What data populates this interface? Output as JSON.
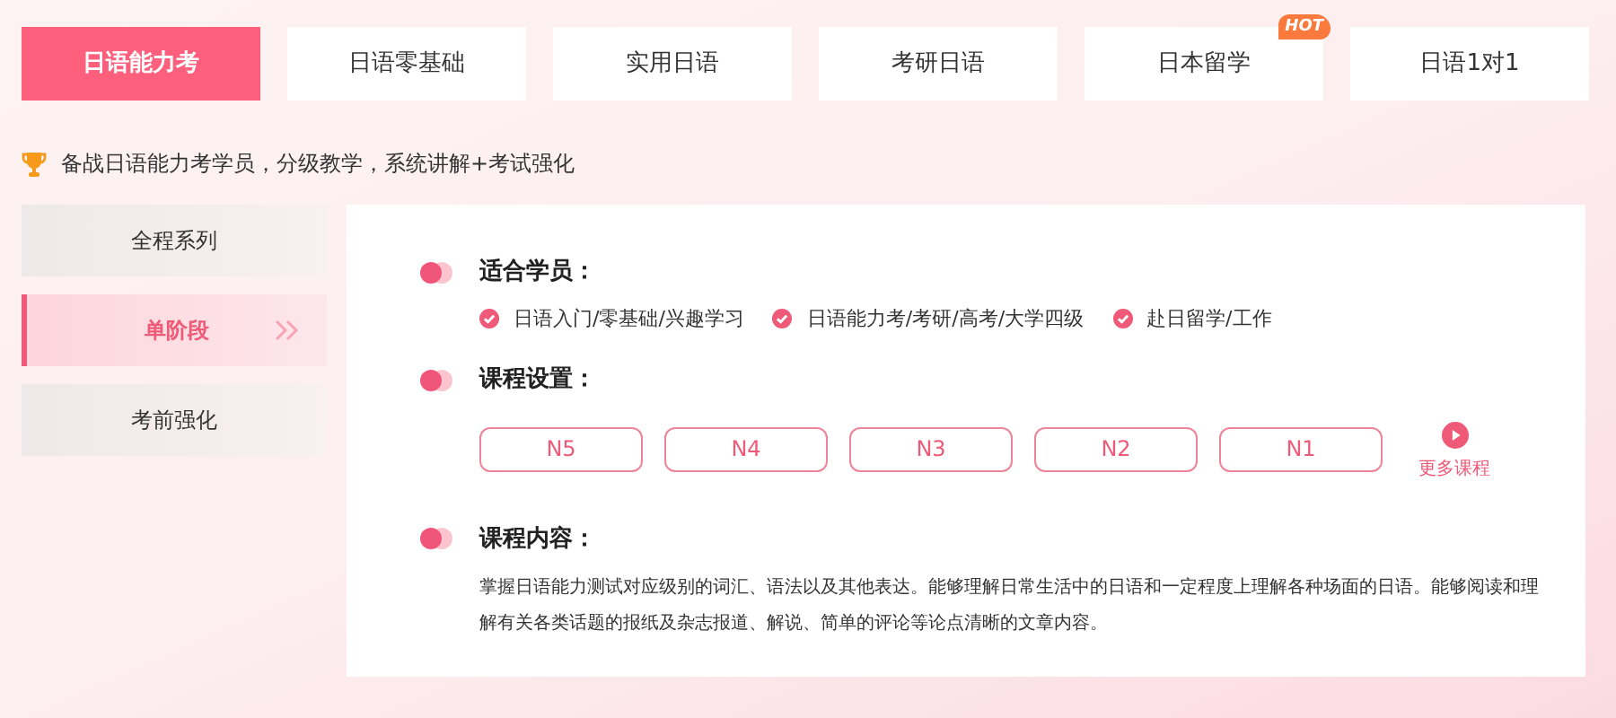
{
  "tabs": [
    {
      "label": "日语能力考",
      "selected": true
    },
    {
      "label": "日语零基础",
      "selected": false
    },
    {
      "label": "实用日语",
      "selected": false
    },
    {
      "label": "考研日语",
      "selected": false
    },
    {
      "label": "日本留学",
      "selected": false,
      "badge": "HOT"
    },
    {
      "label": "日语1对1",
      "selected": false
    }
  ],
  "tagline": "备战日语能力考学员，分级教学，系统讲解+考试强化",
  "sidebar": {
    "items": [
      {
        "label": "全程系列",
        "selected": false
      },
      {
        "label": "单阶段",
        "selected": true
      },
      {
        "label": "考前强化",
        "selected": false
      }
    ]
  },
  "sections": [
    {
      "kind": "checklist",
      "title": "适合学员：",
      "items": [
        "日语入门/零基础/兴趣学习",
        "日语能力考/考研/高考/大学四级",
        "赴日留学/工作"
      ]
    },
    {
      "kind": "levels",
      "title": "课程设置：",
      "items": [
        "N5",
        "N4",
        "N3",
        "N2",
        "N1"
      ],
      "more": "更多课程"
    },
    {
      "kind": "text",
      "title": "课程内容：",
      "text": "掌握日语能力测试对应级别的词汇、语法以及其他表达。能够理解日常生活中的日语和一定程度上理解各种场面的日语。能够阅读和理解有关各类话题的报纸及杂志报道、解说、简单的评论等论点清晰的文章内容。"
    }
  ]
}
